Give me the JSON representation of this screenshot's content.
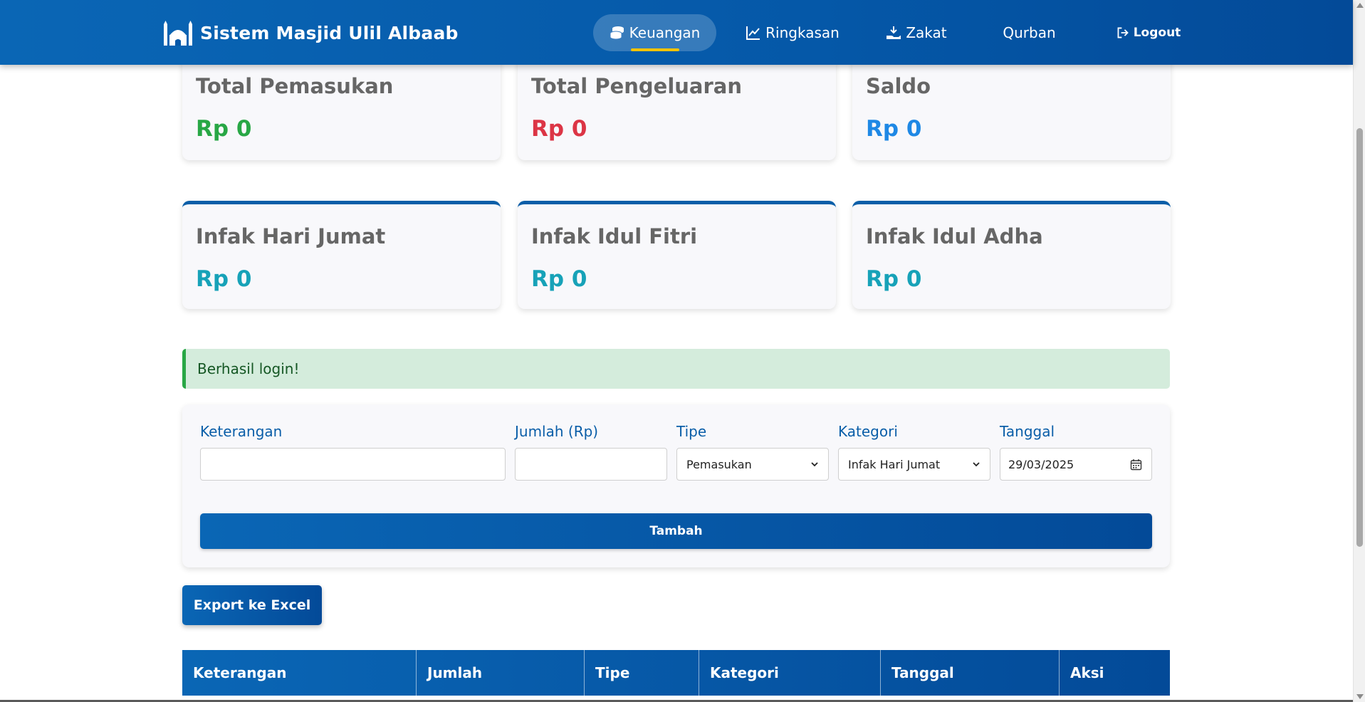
{
  "navbar": {
    "brand": "Sistem Masjid Ulil Albaab",
    "items": [
      {
        "label": "Keuangan",
        "icon": "coins-icon",
        "active": true
      },
      {
        "label": "Ringkasan",
        "icon": "chart-line-icon",
        "active": false
      },
      {
        "label": "Zakat",
        "icon": "hand-holding-icon",
        "active": false
      },
      {
        "label": "Qurban",
        "icon": "",
        "active": false
      },
      {
        "label": "Logout",
        "icon": "sign-out-icon",
        "active": false
      }
    ]
  },
  "summary": {
    "total_pemasukan": {
      "title": "Total Pemasukan",
      "value": "Rp 0",
      "color": "#28a745"
    },
    "total_pengeluaran": {
      "title": "Total Pengeluaran",
      "value": "Rp 0",
      "color": "#dc3545"
    },
    "saldo": {
      "title": "Saldo",
      "value": "Rp 0",
      "color": "#1e88e5"
    }
  },
  "infak": {
    "jumat": {
      "title": "Infak Hari Jumat",
      "value": "Rp 0"
    },
    "idul_fitri": {
      "title": "Infak Idul Fitri",
      "value": "Rp 0"
    },
    "idul_adha": {
      "title": "Infak Idul Adha",
      "value": "Rp 0"
    }
  },
  "alert": {
    "message": "Berhasil login!"
  },
  "form": {
    "keterangan_label": "Keterangan",
    "keterangan_value": "",
    "jumlah_label": "Jumlah (Rp)",
    "jumlah_value": "",
    "tipe_label": "Tipe",
    "tipe_selected": "Pemasukan",
    "kategori_label": "Kategori",
    "kategori_selected": "Infak Hari Jumat",
    "tanggal_label": "Tanggal",
    "tanggal_value": "29/03/2025",
    "submit_label": "Tambah"
  },
  "export_label": "Export ke Excel",
  "table": {
    "columns": [
      "Keterangan",
      "Jumlah",
      "Tipe",
      "Kategori",
      "Tanggal",
      "Aksi"
    ]
  },
  "colors": {
    "primary": "#0a5ea8",
    "accent_underline": "#f2c300",
    "alert_bg": "#d4ecdc"
  }
}
